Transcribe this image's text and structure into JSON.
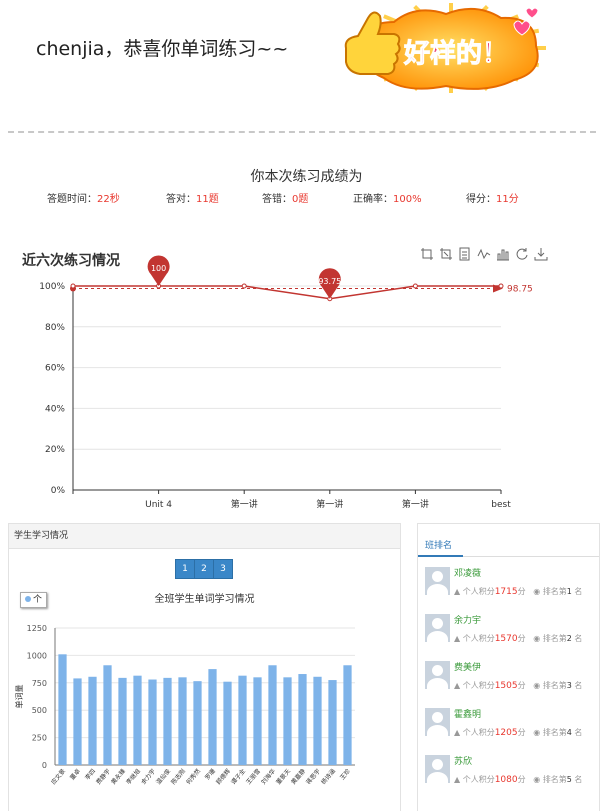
{
  "header": {
    "congrats_text": "chenjia，恭喜你单词练习~~",
    "badge_text": "好样的！"
  },
  "result": {
    "title": "你本次练习成绩为",
    "time_label": "答题时间：",
    "time_value": "22秒",
    "correct_label": "答对：",
    "correct_value": "11题",
    "wrong_label": "答错：",
    "wrong_value": "0题",
    "rate_label": "正确率：",
    "rate_value": "100%",
    "score_label": "得分：",
    "score_value": "11分"
  },
  "line_chart": {
    "title": "近六次练习情况",
    "toolbox_icons": [
      "zoom-icon",
      "zoom-reset-icon",
      "data-view-icon",
      "line-type-icon",
      "bar-type-icon",
      "restore-icon",
      "download-icon"
    ]
  },
  "chart_data": [
    {
      "type": "line",
      "title": "近六次练习情况",
      "categories": [
        "",
        "Unit 4",
        "第一讲",
        "第一讲",
        "第一讲",
        "best"
      ],
      "values": [
        100,
        100,
        100,
        93.75,
        100,
        100
      ],
      "y_ticks": [
        "0%",
        "20%",
        "40%",
        "60%",
        "80%",
        "100%"
      ],
      "ylim": [
        0,
        100
      ],
      "mark_points": [
        {
          "label": "100",
          "index": 1
        },
        {
          "label": "93.75",
          "index": 3
        }
      ],
      "mark_line": {
        "label": "98.75",
        "value": 98.75
      },
      "color": "#c23531"
    },
    {
      "type": "bar",
      "title": "全班学生单词学习情况",
      "legend": "个",
      "ylabel": "单词量",
      "ylim": [
        0,
        1250
      ],
      "y_ticks": [
        "0",
        "250",
        "500",
        "750",
        "1000",
        "1250"
      ],
      "categories": [
        "应文景",
        "董卓",
        "李四",
        "费静宇",
        "黄永臻",
        "李继旭",
        "余力宇",
        "温仙俊",
        "陈志刚",
        "何秀然",
        "罗珊",
        "顾德辉",
        "谭子全",
        "王丽雪",
        "刘海华",
        "董景天",
        "黄嘉静",
        "蒋思宇",
        "杨诗涵",
        "王珍"
      ],
      "values": [
        1010,
        790,
        805,
        910,
        795,
        815,
        780,
        795,
        800,
        765,
        875,
        760,
        815,
        800,
        910,
        800,
        830,
        805,
        775,
        910
      ],
      "color": "#7eb3e9"
    }
  ],
  "study_panel": {
    "title": "学生学习情况",
    "pages": [
      "1",
      "2",
      "3"
    ]
  },
  "rank_panel": {
    "tab": "班排名",
    "items": [
      {
        "name": "邓凌薇",
        "prefix": "个人积分",
        "points": "1715",
        "unit": "分",
        "rank_prefix": "排名第",
        "rank": "1",
        "rank_unit": "名"
      },
      {
        "name": "余力宇",
        "prefix": "个人积分",
        "points": "1570",
        "unit": "分",
        "rank_prefix": "排名第",
        "rank": "2",
        "rank_unit": "名"
      },
      {
        "name": "费美伊",
        "prefix": "个人积分",
        "points": "1505",
        "unit": "分",
        "rank_prefix": "排名第",
        "rank": "3",
        "rank_unit": "名"
      },
      {
        "name": "霍鑫明",
        "prefix": "个人积分",
        "points": "1205",
        "unit": "分",
        "rank_prefix": "排名第",
        "rank": "4",
        "rank_unit": "名"
      },
      {
        "name": "苏欣",
        "prefix": "个人积分",
        "points": "1080",
        "unit": "分",
        "rank_prefix": "排名第",
        "rank": "5",
        "rank_unit": "名"
      }
    ]
  }
}
